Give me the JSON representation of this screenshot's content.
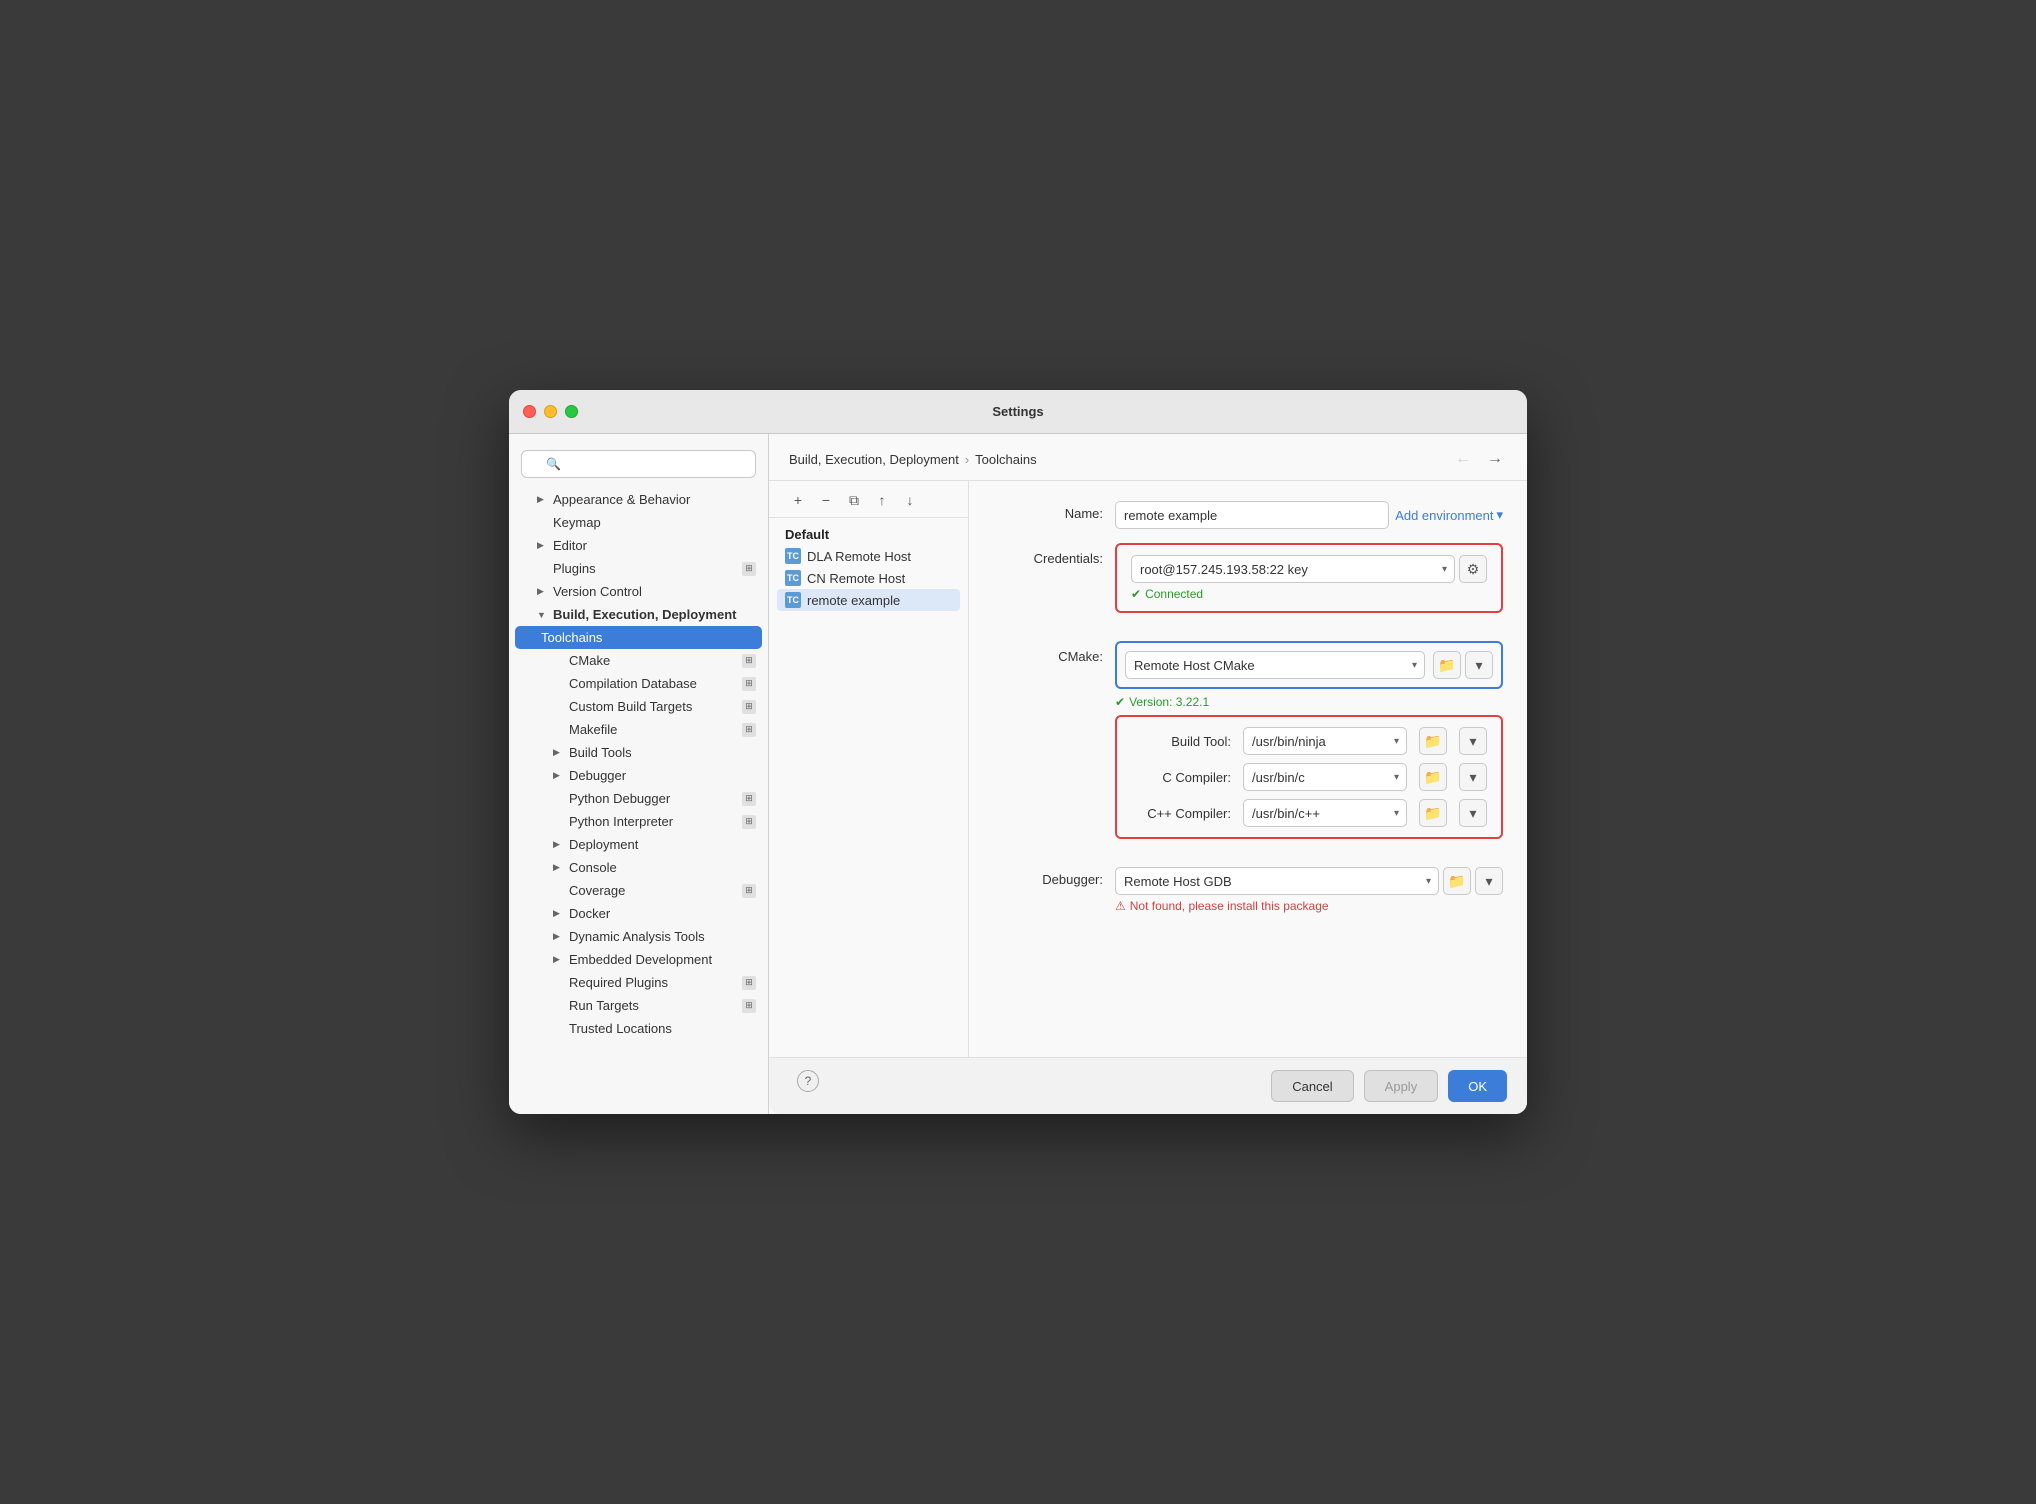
{
  "window": {
    "title": "Settings"
  },
  "sidebar": {
    "search_placeholder": "🔍",
    "items": [
      {
        "id": "appearance",
        "label": "Appearance & Behavior",
        "indent": 1,
        "expandable": true,
        "badge": false
      },
      {
        "id": "keymap",
        "label": "Keymap",
        "indent": 1,
        "expandable": false,
        "badge": false
      },
      {
        "id": "editor",
        "label": "Editor",
        "indent": 1,
        "expandable": true,
        "badge": false
      },
      {
        "id": "plugins",
        "label": "Plugins",
        "indent": 1,
        "expandable": false,
        "badge": true
      },
      {
        "id": "version-control",
        "label": "Version Control",
        "indent": 1,
        "expandable": true,
        "badge": false
      },
      {
        "id": "build-execution-deployment",
        "label": "Build, Execution, Deployment",
        "indent": 1,
        "expandable": true,
        "active_parent": true,
        "badge": false
      },
      {
        "id": "toolchains",
        "label": "Toolchains",
        "indent": 2,
        "expandable": false,
        "active": true,
        "badge": false
      },
      {
        "id": "cmake",
        "label": "CMake",
        "indent": 2,
        "expandable": false,
        "badge": true
      },
      {
        "id": "compilation-db",
        "label": "Compilation Database",
        "indent": 2,
        "expandable": false,
        "badge": true
      },
      {
        "id": "custom-build-targets",
        "label": "Custom Build Targets",
        "indent": 2,
        "expandable": false,
        "badge": true
      },
      {
        "id": "makefile",
        "label": "Makefile",
        "indent": 2,
        "expandable": false,
        "badge": true
      },
      {
        "id": "build-tools",
        "label": "Build Tools",
        "indent": 2,
        "expandable": true,
        "badge": false
      },
      {
        "id": "debugger",
        "label": "Debugger",
        "indent": 2,
        "expandable": true,
        "badge": false
      },
      {
        "id": "python-debugger",
        "label": "Python Debugger",
        "indent": 2,
        "expandable": false,
        "badge": true
      },
      {
        "id": "python-interpreter",
        "label": "Python Interpreter",
        "indent": 2,
        "expandable": false,
        "badge": true
      },
      {
        "id": "deployment",
        "label": "Deployment",
        "indent": 2,
        "expandable": true,
        "badge": false
      },
      {
        "id": "console",
        "label": "Console",
        "indent": 2,
        "expandable": true,
        "badge": false
      },
      {
        "id": "coverage",
        "label": "Coverage",
        "indent": 2,
        "expandable": false,
        "badge": true
      },
      {
        "id": "docker",
        "label": "Docker",
        "indent": 2,
        "expandable": true,
        "badge": false
      },
      {
        "id": "dynamic-analysis-tools",
        "label": "Dynamic Analysis Tools",
        "indent": 2,
        "expandable": true,
        "badge": false
      },
      {
        "id": "embedded-development",
        "label": "Embedded Development",
        "indent": 2,
        "expandable": true,
        "badge": false
      },
      {
        "id": "required-plugins",
        "label": "Required Plugins",
        "indent": 2,
        "expandable": false,
        "badge": true
      },
      {
        "id": "run-targets",
        "label": "Run Targets",
        "indent": 2,
        "expandable": false,
        "badge": true
      },
      {
        "id": "trusted-locations",
        "label": "Trusted Locations",
        "indent": 2,
        "expandable": false,
        "badge": false
      }
    ]
  },
  "breadcrumb": {
    "parent": "Build, Execution, Deployment",
    "current": "Toolchains"
  },
  "toolbar": {
    "add_label": "+",
    "remove_label": "−",
    "copy_label": "⧉",
    "up_label": "↑",
    "down_label": "↓"
  },
  "toolchains": {
    "items": [
      {
        "id": "default",
        "label": "Default",
        "is_default": true
      },
      {
        "id": "dla-remote",
        "label": "DLA Remote Host",
        "icon": "TC"
      },
      {
        "id": "cn-remote",
        "label": "CN Remote Host",
        "icon": "TC"
      },
      {
        "id": "remote-example",
        "label": "remote example",
        "icon": "TC"
      }
    ]
  },
  "form": {
    "name_label": "Name:",
    "name_value": "remote example",
    "add_environment_label": "Add environment",
    "credentials_label": "Credentials:",
    "credentials_value": "root@157.245.193.58:22 key",
    "connected_status": "Connected",
    "cmake_label": "CMake:",
    "cmake_value": "Remote Host CMake",
    "cmake_version": "Version: 3.22.1",
    "build_tool_label": "Build Tool:",
    "build_tool_value": "/usr/bin/ninja",
    "c_compiler_label": "C Compiler:",
    "c_compiler_value": "/usr/bin/c",
    "cpp_compiler_label": "C++ Compiler:",
    "cpp_compiler_value": "/usr/bin/c++",
    "debugger_label": "Debugger:",
    "debugger_value": "Remote Host GDB",
    "debugger_error": "Not found, please install this package"
  },
  "footer": {
    "cancel_label": "Cancel",
    "apply_label": "Apply",
    "ok_label": "OK"
  }
}
